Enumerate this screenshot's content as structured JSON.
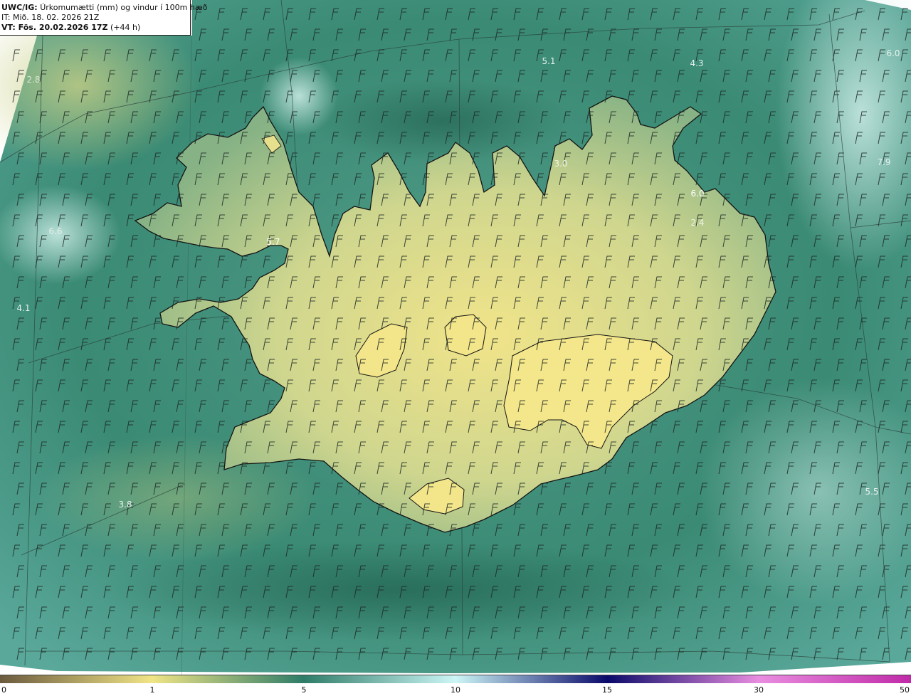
{
  "header": {
    "product_code": "UWC/IG:",
    "product_title": "Úrkomumætti (mm) og vindur í 100m hæð",
    "init_time": "IT: Mið. 18. 02. 2026 21Z",
    "valid_label": "VT: Fös. 20.02.2026 17Z",
    "lead_time": "(+44 h)"
  },
  "colorbar": {
    "ticks": [
      "0",
      "1",
      "5",
      "10",
      "15",
      "30",
      "50"
    ],
    "stops": [
      {
        "value": "0",
        "color": "#6b5a3e"
      },
      {
        "value": "1",
        "color": "#f0e486"
      },
      {
        "value": "5",
        "color": "#2e7c68"
      },
      {
        "value": "10",
        "color": "#cdf6f6"
      },
      {
        "value": "15",
        "color": "#0a0a6a"
      },
      {
        "value": "30",
        "color": "#e98de0"
      },
      {
        "value": "50",
        "color": "#c02aa8"
      }
    ]
  },
  "map_values": [
    {
      "text": "2.8",
      "color": "#d8e6d0"
    },
    {
      "text": "6.6",
      "color": "#e6f0ec"
    },
    {
      "text": "4.1",
      "color": "#e6f0ec"
    },
    {
      "text": "3.8",
      "color": "#e6f0ec"
    },
    {
      "text": "5.7",
      "color": "#ffffff"
    },
    {
      "text": "5.1",
      "color": "#e6f0ec"
    },
    {
      "text": "4.3",
      "color": "#e6f0ec"
    },
    {
      "text": "6.0",
      "color": "#e6f0ec"
    },
    {
      "text": "3.0",
      "color": "#f0f4e6"
    },
    {
      "text": "6.0",
      "color": "#ffffff"
    },
    {
      "text": "2.4",
      "color": "#f0f4e6"
    },
    {
      "text": "7.9",
      "color": "#e6f0ec"
    },
    {
      "text": "5.5",
      "color": "#e6f0ec"
    }
  ],
  "colors": {
    "ocean": "#2e7c68",
    "ocean_light": "#5fa898",
    "ocean_dark": "#23614f",
    "land_high": "#eee48c",
    "land_mid": "#a4c48a",
    "coast": "#1a1a1a",
    "barb": "#1f2a26"
  }
}
